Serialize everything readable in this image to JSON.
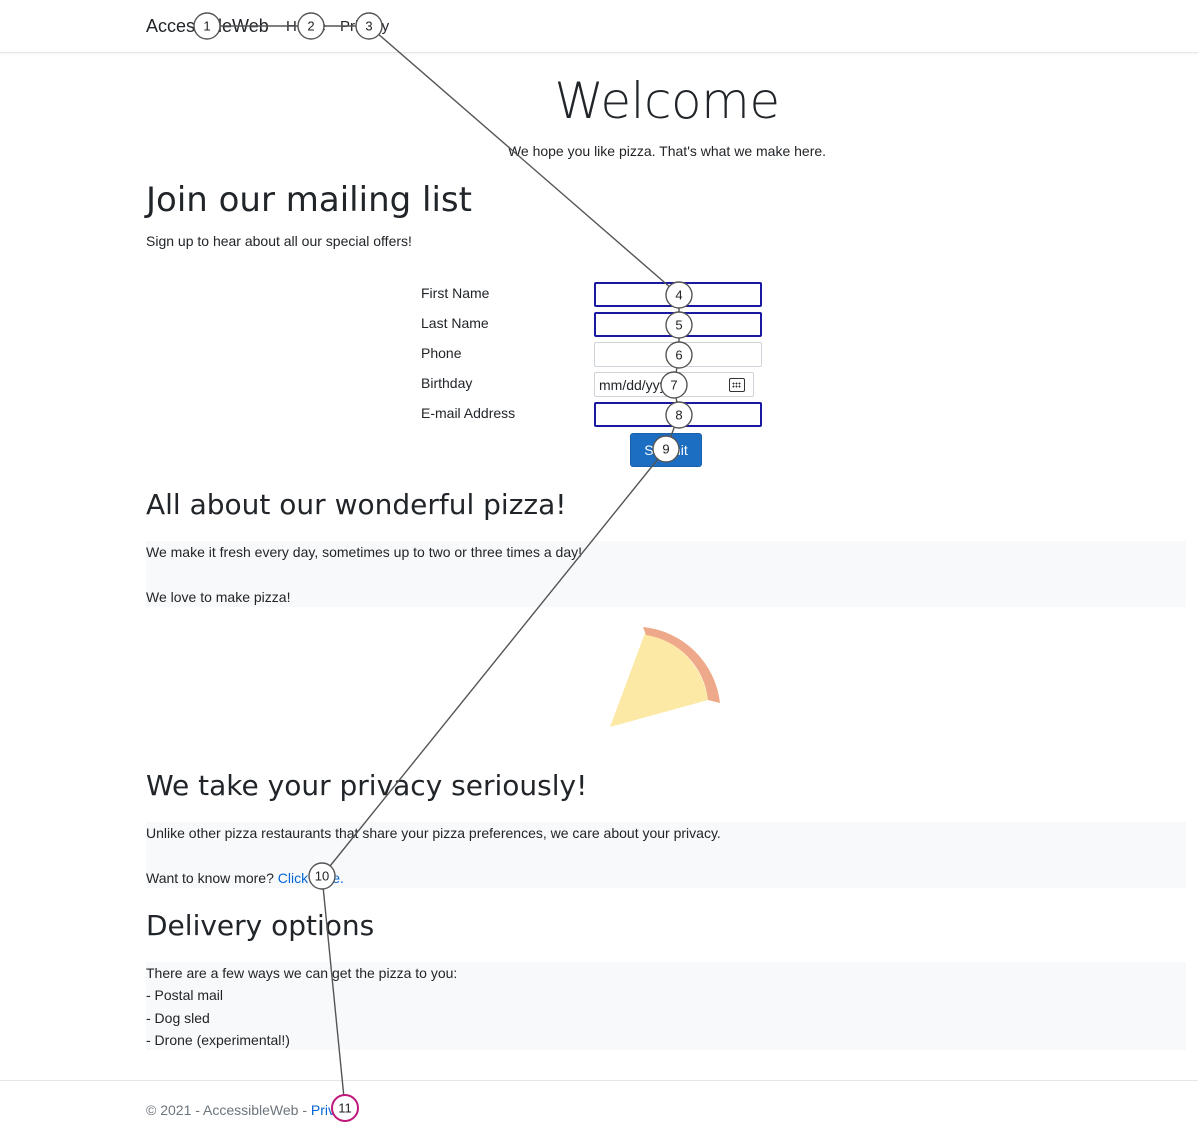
{
  "nav": {
    "brand": "AccessibleWeb",
    "home": "Home",
    "privacy": "Privacy"
  },
  "hero": {
    "title": "Welcome",
    "subtitle": "We hope you like pizza. That's what we make here."
  },
  "mailing": {
    "heading": "Join our mailing list",
    "text": "Sign up to hear about all our special offers!",
    "fields": [
      {
        "label": "First Name",
        "value": ""
      },
      {
        "label": "Last Name",
        "value": ""
      },
      {
        "label": "Phone",
        "value": ""
      },
      {
        "label": "Birthday",
        "value": "mm/dd/yyyy"
      },
      {
        "label": "E-mail Address",
        "value": ""
      }
    ],
    "submit_label": "Submit"
  },
  "pizza": {
    "heading": "All about our wonderful pizza!",
    "line1": "We make it fresh every day, sometimes up to two or three times a day!",
    "line2": "We love to make pizza!",
    "crust_color": "#eea98a",
    "cheese_color": "#fde9a6"
  },
  "privacy": {
    "heading": "We take your privacy seriously!",
    "line1": "Unlike other pizza restaurants that share your pizza preferences, we care about your privacy.",
    "line2_prefix": "Want to know more? ",
    "line2_link": "Click here."
  },
  "delivery": {
    "heading": "Delivery options",
    "lines": [
      "There are a few ways we can get the pizza to you:",
      "- Postal mail",
      "- Dog sled",
      "- Drone (experimental!)"
    ]
  },
  "footer": {
    "text_prefix": "© 2021 - AccessibleWeb - ",
    "link": "Privacy"
  },
  "markers": [
    "1",
    "2",
    "3",
    "4",
    "5",
    "6",
    "7",
    "8",
    "9",
    "10",
    "11"
  ],
  "colors": {
    "primary": "#1b6ec2",
    "focus_border": "#1a17a0",
    "band": "#f8f9fa",
    "link": "#0366d6",
    "marker_highlight": "#c0177a"
  }
}
